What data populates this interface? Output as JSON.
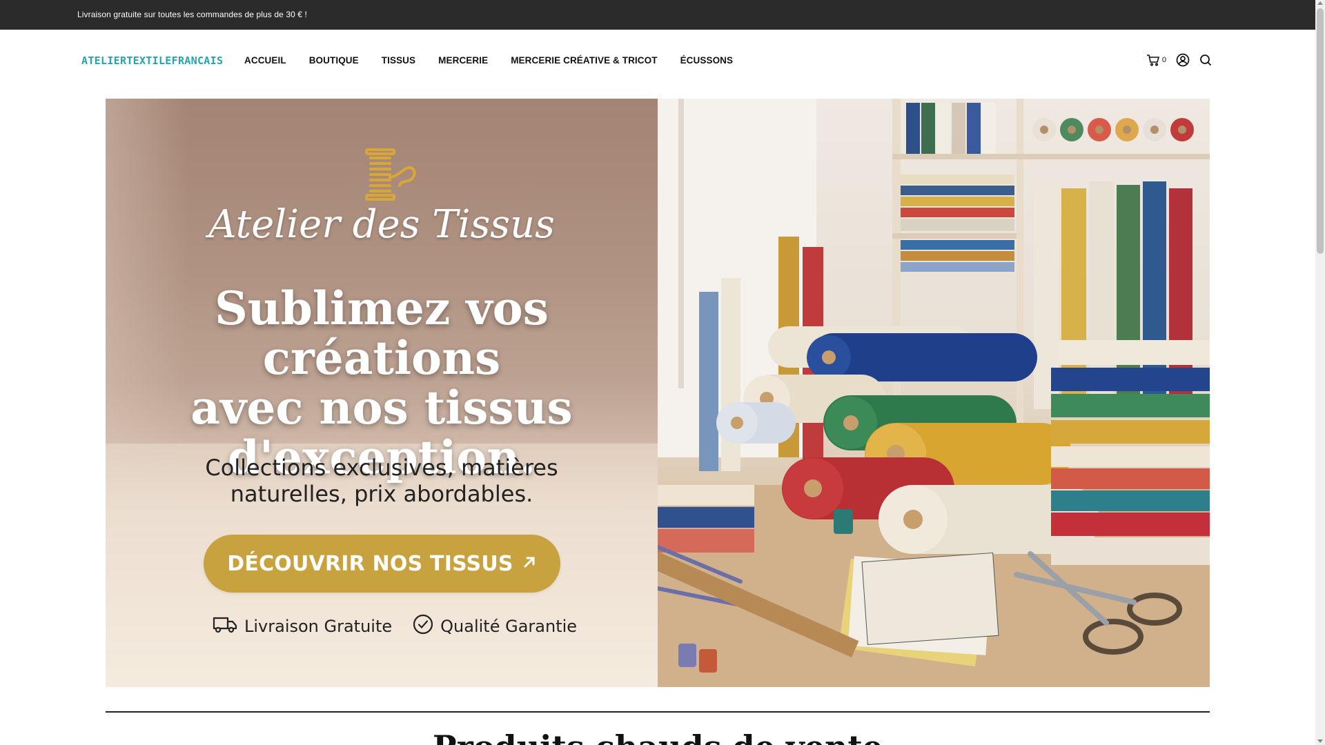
{
  "announcement": {
    "text": "Livraison gratuite sur toutes les commandes de plus de 30 € !"
  },
  "header": {
    "logo": "ATELIERTEXTILEFRANCAIS",
    "nav": [
      "ACCUEIL",
      "BOUTIQUE",
      "TISSUS",
      "MERCERIE",
      "MERCERIE CRÉATIVE & TRICOT",
      "ÉCUSSONS"
    ],
    "cart_count": "0",
    "icons": [
      "cart-icon",
      "account-icon",
      "search-icon"
    ]
  },
  "hero": {
    "brand_script": "Atelier des Tissus",
    "headline_lines": [
      "Sublimez vos créations",
      "avec nos tissus",
      "d'exception."
    ],
    "subline_lines": [
      "Collections exclusives, matières",
      "naturelles, prix abordables."
    ],
    "cta_label": "DÉCOUVRIR NOS TISSUS",
    "badges": [
      "Livraison Gratuite",
      "Qualité Garantie"
    ],
    "image_subject": "fabric-rolls-photo"
  },
  "section": {
    "title": "Produits chauds de vente"
  },
  "colors": {
    "accent": "#25a3b0",
    "cta": "#c9a240",
    "topbar": "#2b2b2b"
  }
}
